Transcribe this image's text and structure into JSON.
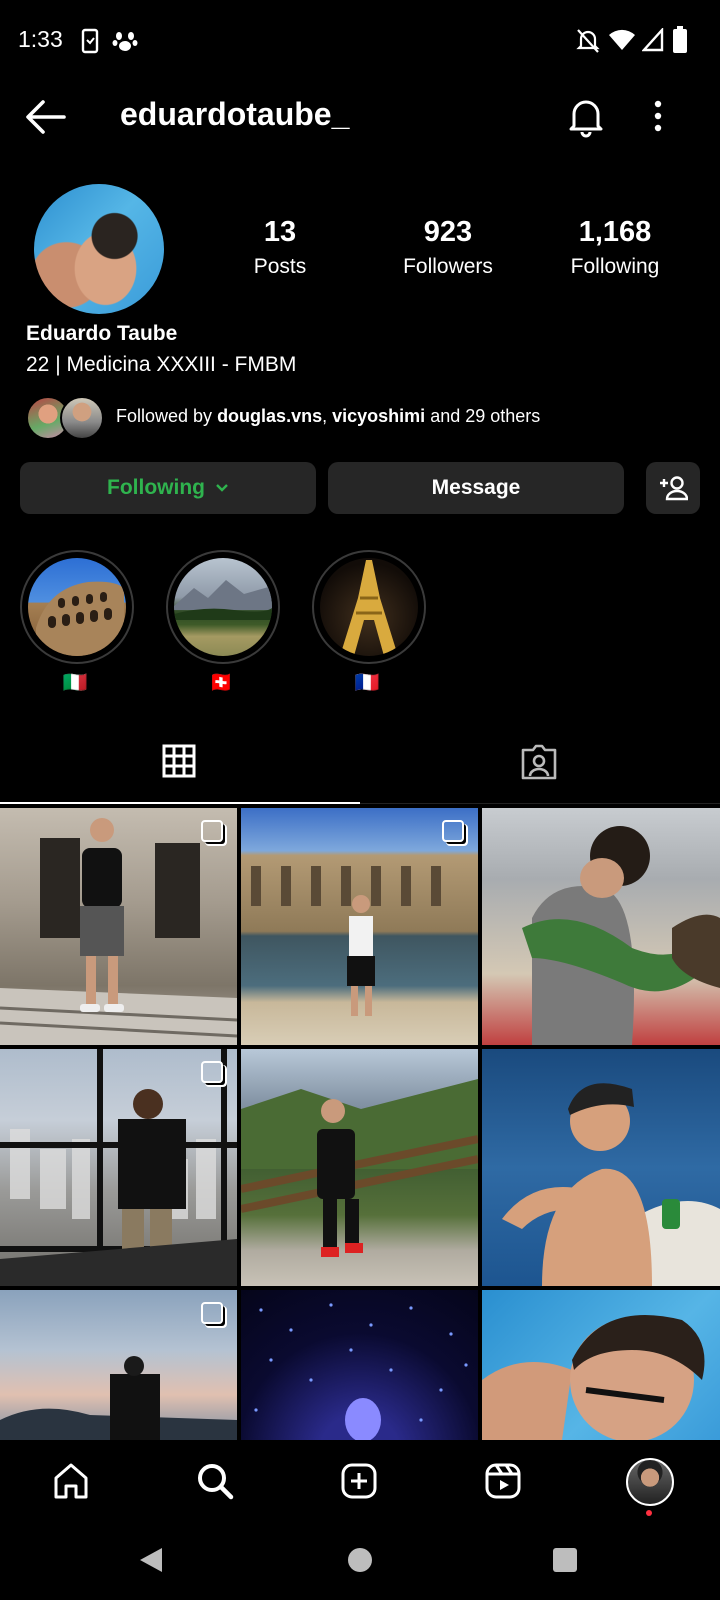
{
  "status_bar": {
    "time": "1:33"
  },
  "header": {
    "username": "eduardotaube_"
  },
  "stats": [
    {
      "count": "13",
      "label": "Posts"
    },
    {
      "count": "923",
      "label": "Followers"
    },
    {
      "count": "1,168",
      "label": "Following"
    }
  ],
  "profile": {
    "full_name": "Eduardo Taube",
    "bio": "22 | Medicina XXXIII - FMBM",
    "followed_by": {
      "prefix": "Followed by",
      "user1": "douglas.vns",
      "separator": ",",
      "user2": "vicyoshimi",
      "suffix": "and 29 others"
    }
  },
  "buttons": {
    "following": "Following",
    "message": "Message"
  },
  "highlights": [
    {
      "flag": "🇮🇹",
      "icon": "colosseum"
    },
    {
      "flag": "🇨🇭",
      "icon": "mountains"
    },
    {
      "flag": "🇫🇷",
      "icon": "eiffel-tower"
    }
  ],
  "tabs": [
    {
      "icon": "grid-icon",
      "active": true
    },
    {
      "icon": "tagged-icon",
      "active": false
    }
  ],
  "bottom_nav": [
    "home-icon",
    "search-icon",
    "create-icon",
    "reels-icon",
    "profile-avatar"
  ],
  "colors": {
    "accent_green": "#2fb34e",
    "button_bg": "#262626",
    "background": "#000000"
  }
}
